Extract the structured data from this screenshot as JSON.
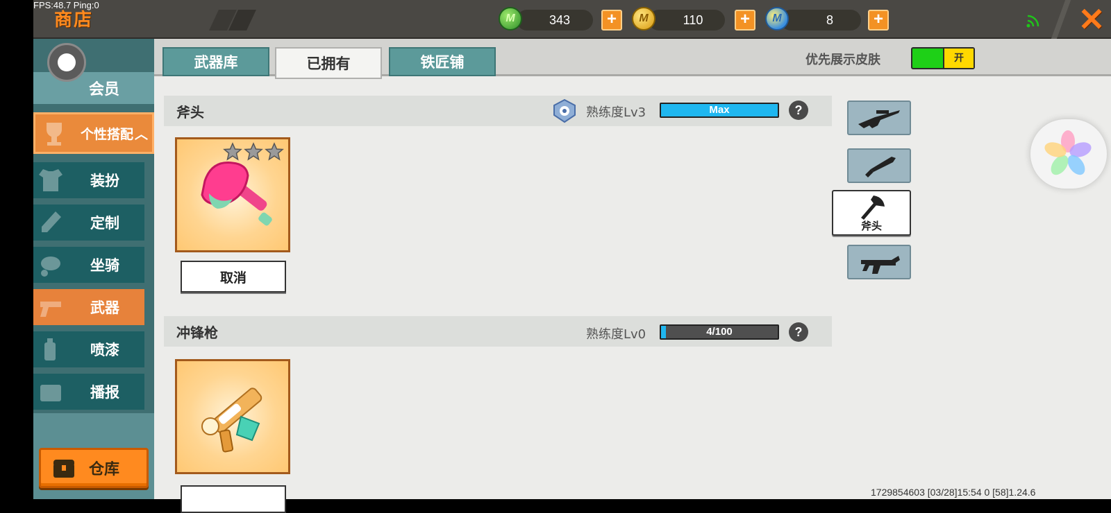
{
  "hud": {
    "fps_ping": "FPS:48.7  Ping:0"
  },
  "header": {
    "title": "商店"
  },
  "currencies": [
    {
      "name": "green-gem",
      "value": "343",
      "color": "#3fa33a",
      "symbol": "M"
    },
    {
      "name": "gold-coin",
      "value": "110",
      "color": "#e7b81e",
      "symbol": "M"
    },
    {
      "name": "blue-coin",
      "value": "8",
      "color": "#4fa7e6",
      "symbol": "M"
    }
  ],
  "sidebar": {
    "member": "会员",
    "outfit_group": "个性搭配",
    "items": [
      {
        "label": "装扮",
        "icon": "shirt-icon"
      },
      {
        "label": "定制",
        "icon": "pencil-icon"
      },
      {
        "label": "坐骑",
        "icon": "mount-icon"
      },
      {
        "label": "武器",
        "icon": "revolver-icon",
        "active": true
      },
      {
        "label": "喷漆",
        "icon": "spray-can-icon"
      },
      {
        "label": "播报",
        "icon": "broadcast-icon"
      }
    ],
    "warehouse": "仓库"
  },
  "tabs": [
    {
      "label": "武器库",
      "active": false
    },
    {
      "label": "已拥有",
      "active": true
    },
    {
      "label": "铁匠铺",
      "active": false
    }
  ],
  "skin_toggle": {
    "label": "优先展示皮肤",
    "state": "开"
  },
  "weapons": [
    {
      "name": "斧头",
      "proficiency": "熟练度Lv3",
      "bar_text": "Max",
      "progress": 1.0,
      "stars": 3,
      "button": "取消"
    },
    {
      "name": "冲锋枪",
      "proficiency": "熟练度Lv0",
      "bar_text": "4/100",
      "progress": 0.04
    }
  ],
  "help_symbol": "?",
  "weapon_filters": [
    {
      "icon": "sniper-rifle-icon"
    },
    {
      "icon": "knife-icon"
    },
    {
      "icon": "axe-icon",
      "label": "斧头",
      "active": true
    },
    {
      "icon": "submachine-gun-icon"
    }
  ],
  "footer": {
    "build_info": "1729854603   [03/28]15:54 0   [58]1.24.6"
  },
  "colors": {
    "accent_orange": "#ff8a1f",
    "teal": "#5c9a9a",
    "progress_blue": "#1fb7f0"
  }
}
